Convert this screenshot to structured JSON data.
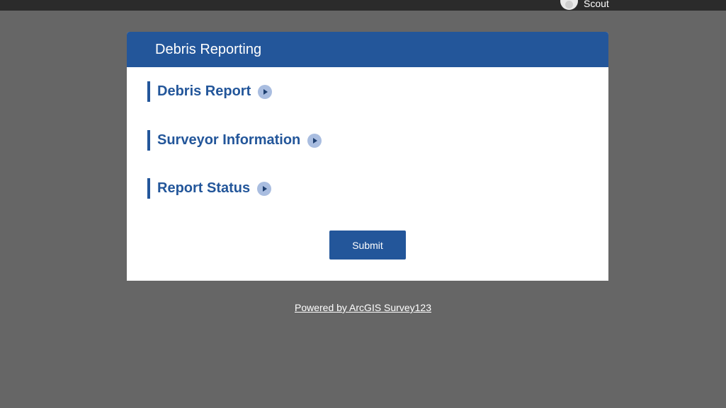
{
  "topbar": {
    "username": "Scout",
    "avatar_icon": "user-avatar-icon"
  },
  "form": {
    "title": "Debris Reporting",
    "groups": [
      {
        "label": "Debris Report",
        "icon": "chevron-right-circle-icon"
      },
      {
        "label": "Surveyor Information",
        "icon": "chevron-right-circle-icon"
      },
      {
        "label": "Report Status",
        "icon": "chevron-right-circle-icon"
      }
    ],
    "submit_label": "Submit"
  },
  "footer": {
    "powered_by": "Powered by ArcGIS Survey123"
  },
  "colors": {
    "accent": "#23569a",
    "background": "#666666",
    "topbar": "#2b2b2b"
  }
}
